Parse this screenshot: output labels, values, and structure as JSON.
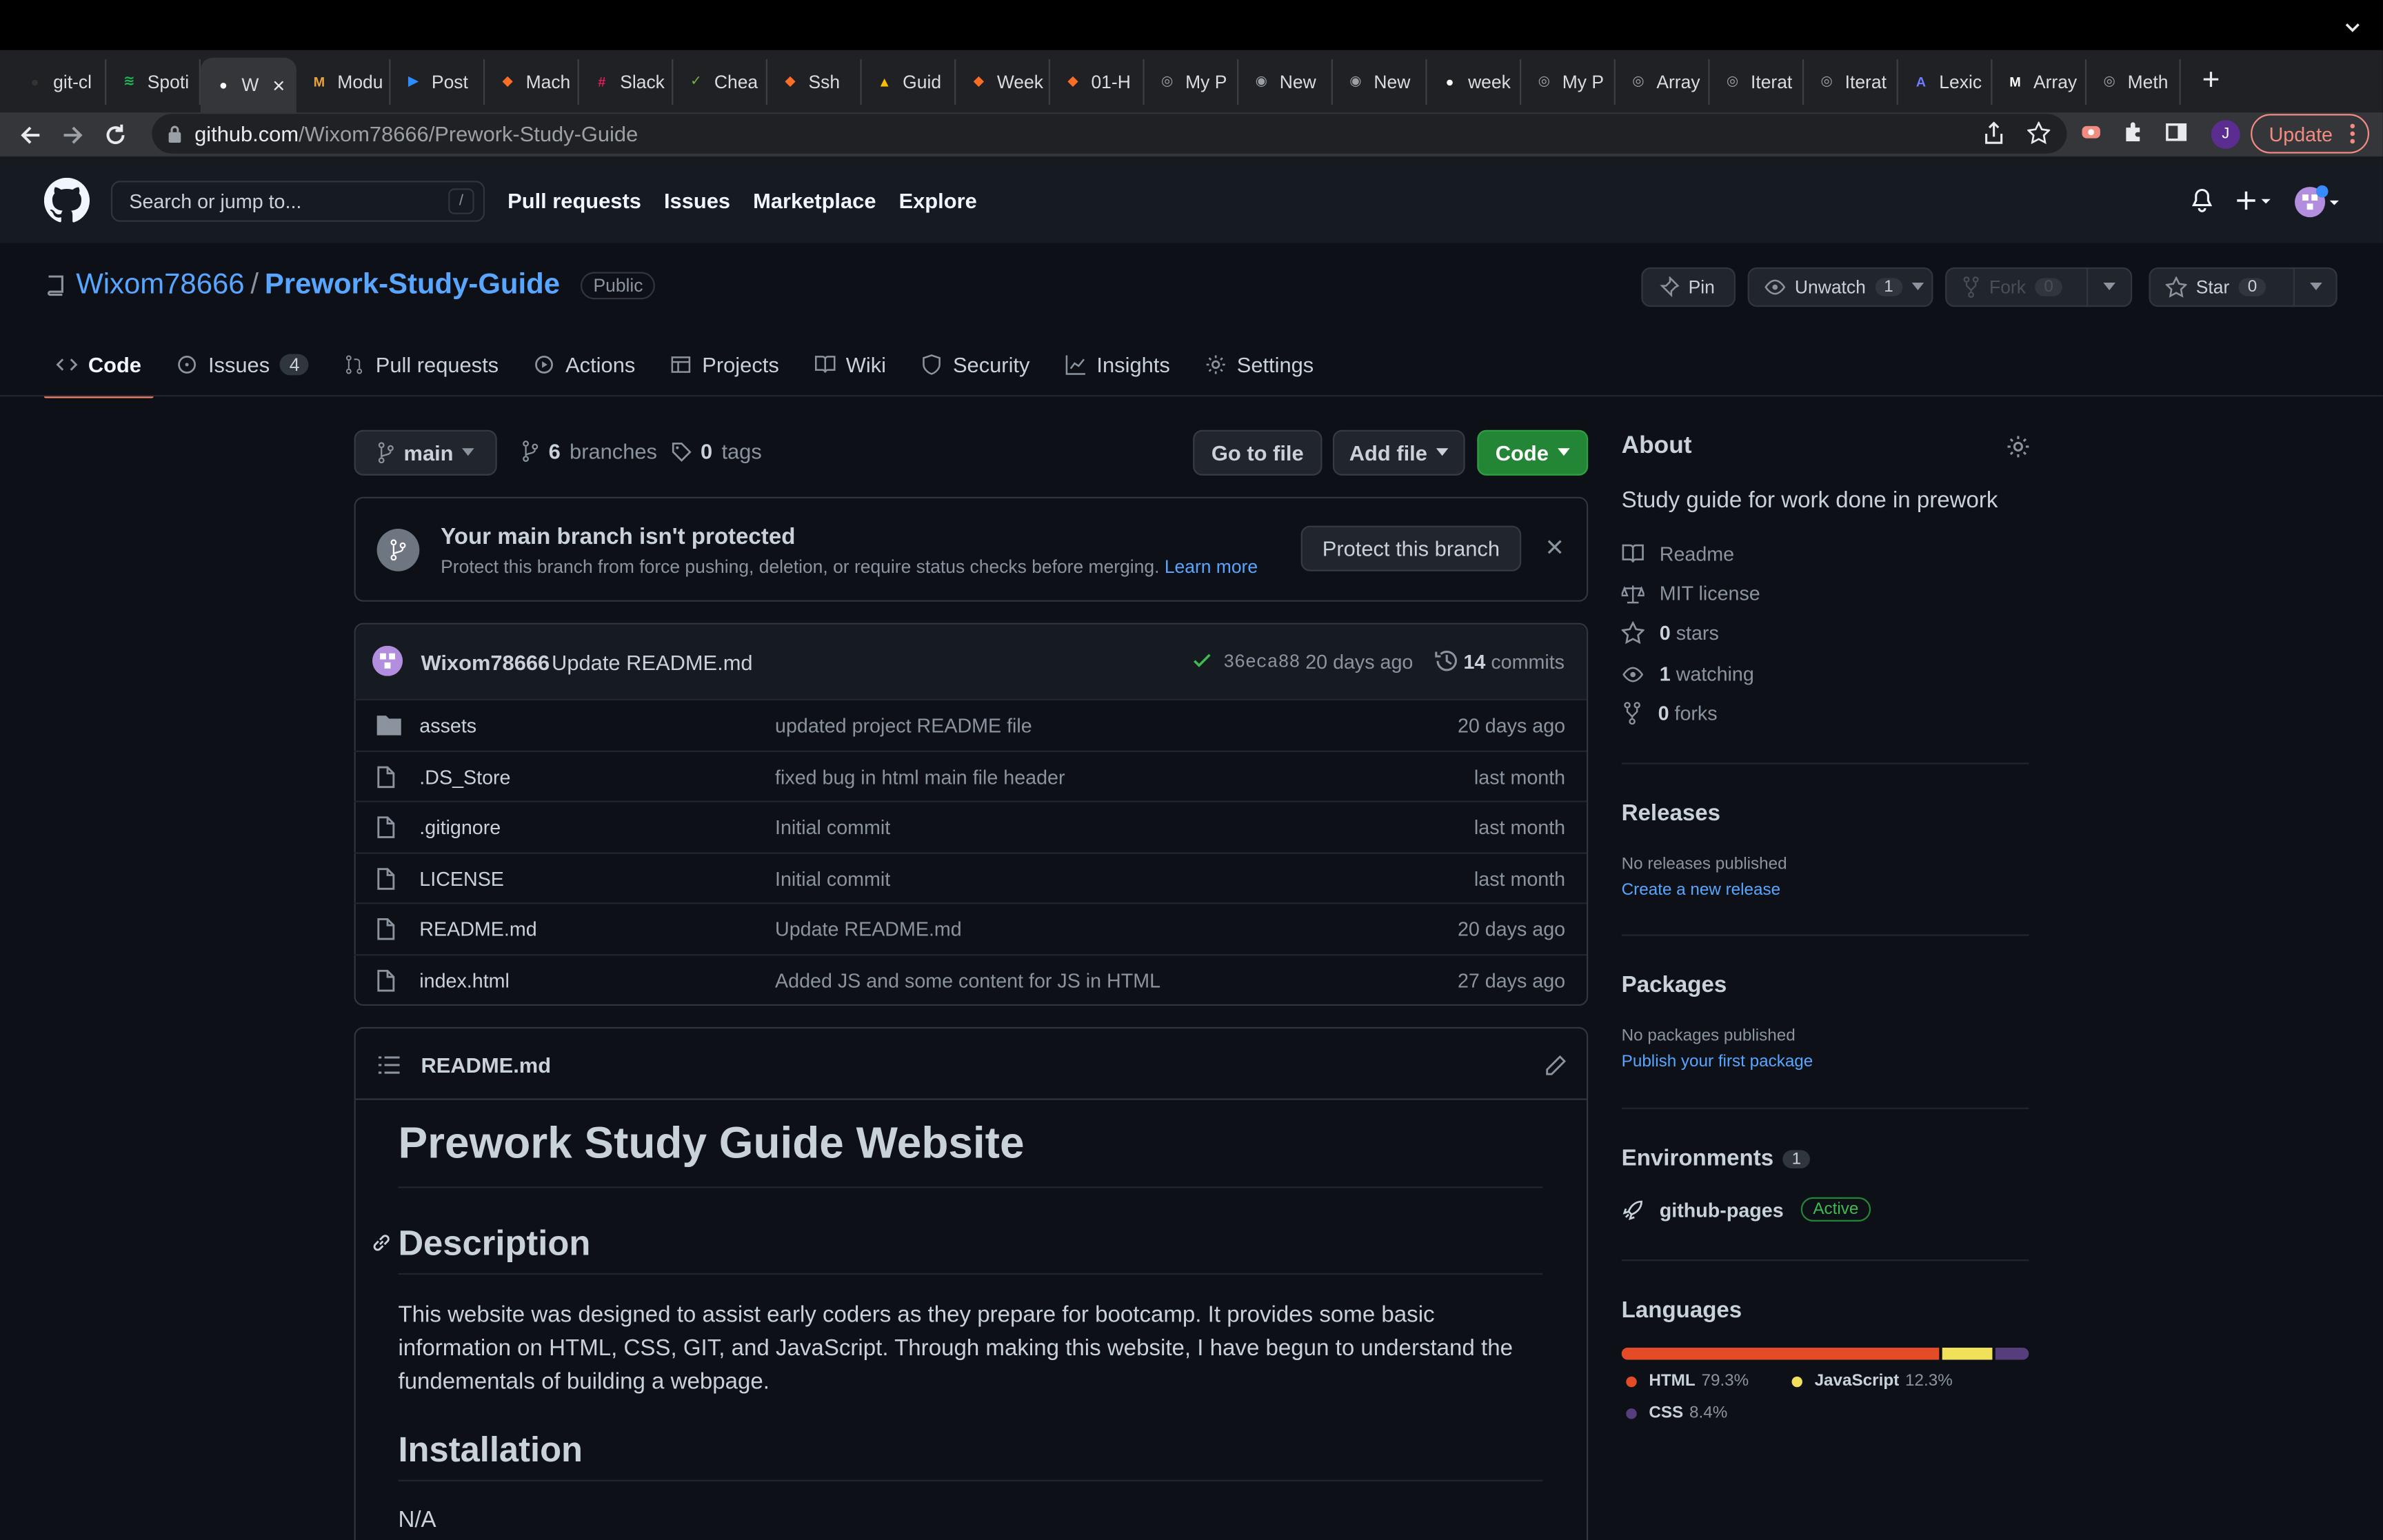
{
  "browser": {
    "tabs": [
      {
        "label": "git-cl",
        "icon": "github-icon",
        "color": "#333"
      },
      {
        "label": "Spoti",
        "icon": "spotify-icon",
        "color": "#1db954"
      },
      {
        "label": "W",
        "icon": "github-icon",
        "color": "#fff",
        "active": true
      },
      {
        "label": "Modu",
        "icon": "module-icon",
        "color": "#e8a33d"
      },
      {
        "label": "Post",
        "icon": "zoom-icon",
        "color": "#2d8cff"
      },
      {
        "label": "Mach",
        "icon": "gitlab-icon",
        "color": "#fc6d26"
      },
      {
        "label": "Slack",
        "icon": "slack-icon",
        "color": "#e01e5a"
      },
      {
        "label": "Chea",
        "icon": "cheatsheet-icon",
        "color": "#7cb342"
      },
      {
        "label": "Ssh",
        "icon": "gitlab-icon",
        "color": "#fc6d26"
      },
      {
        "label": "Guid",
        "icon": "google-drive-icon",
        "color": "#fbbc04"
      },
      {
        "label": "Week",
        "icon": "gitlab-icon",
        "color": "#fc6d26"
      },
      {
        "label": "01-H",
        "icon": "gitlab-icon",
        "color": "#fc6d26"
      },
      {
        "label": "My P",
        "icon": "globe-icon",
        "color": "#9aa0a6"
      },
      {
        "label": "New",
        "icon": "chrome-icon",
        "color": "#9aa0a6"
      },
      {
        "label": "New",
        "icon": "chrome-icon",
        "color": "#9aa0a6"
      },
      {
        "label": "week",
        "icon": "github-icon",
        "color": "#fff"
      },
      {
        "label": "My P",
        "icon": "globe-icon",
        "color": "#9aa0a6"
      },
      {
        "label": "Array",
        "icon": "globe-icon",
        "color": "#9aa0a6"
      },
      {
        "label": "Iterat",
        "icon": "globe-icon",
        "color": "#9aa0a6"
      },
      {
        "label": "Iterat",
        "icon": "globe-icon",
        "color": "#9aa0a6"
      },
      {
        "label": "Lexic",
        "icon": "lexical-icon",
        "color": "#6e7bff"
      },
      {
        "label": "Array",
        "icon": "mdn-icon",
        "color": "#fff"
      },
      {
        "label": "Meth",
        "icon": "globe-icon",
        "color": "#9aa0a6"
      }
    ],
    "url_host": "github.com",
    "url_path": "/Wixom78666/Prework-Study-Guide",
    "update_label": "Update",
    "profile_initial": "J"
  },
  "header": {
    "search_placeholder": "Search or jump to...",
    "search_shortcut": "/",
    "nav": [
      "Pull requests",
      "Issues",
      "Marketplace",
      "Explore"
    ]
  },
  "repo": {
    "owner": "Wixom78666",
    "separator": "/",
    "name": "Prework-Study-Guide",
    "visibility": "Public",
    "pin_label": "Pin",
    "watch_label": "Unwatch",
    "watch_count": "1",
    "fork_label": "Fork",
    "fork_count": "0",
    "star_label": "Star",
    "star_count": "0",
    "tabs": [
      {
        "label": "Code",
        "icon": "code-icon"
      },
      {
        "label": "Issues",
        "icon": "issue-icon",
        "count": "4"
      },
      {
        "label": "Pull requests",
        "icon": "pull-request-icon"
      },
      {
        "label": "Actions",
        "icon": "play-icon"
      },
      {
        "label": "Projects",
        "icon": "table-icon"
      },
      {
        "label": "Wiki",
        "icon": "book-icon"
      },
      {
        "label": "Security",
        "icon": "shield-icon"
      },
      {
        "label": "Insights",
        "icon": "graph-icon"
      },
      {
        "label": "Settings",
        "icon": "gear-icon"
      }
    ]
  },
  "toolbar": {
    "branch": "main",
    "branches_count": "6",
    "branches_label": "branches",
    "tags_count": "0",
    "tags_label": "tags",
    "go_to_file": "Go to file",
    "add_file": "Add file",
    "code": "Code"
  },
  "protect": {
    "title": "Your main branch isn't protected",
    "subtitle": "Protect this branch from force pushing, deletion, or require status checks before merging.",
    "learn_more": "Learn more",
    "button": "Protect this branch"
  },
  "commit": {
    "author": "Wixom78666",
    "message": "Update README.md",
    "sha": "36eca88",
    "age": "20 days ago",
    "commits_count": "14",
    "commits_label": "commits"
  },
  "files": [
    {
      "name": "assets",
      "type": "folder",
      "message": "updated project README file",
      "age": "20 days ago"
    },
    {
      "name": ".DS_Store",
      "type": "file",
      "message": "fixed bug in html main file header",
      "age": "last month"
    },
    {
      "name": ".gitignore",
      "type": "file",
      "message": "Initial commit",
      "age": "last month"
    },
    {
      "name": "LICENSE",
      "type": "file",
      "message": "Initial commit",
      "age": "last month"
    },
    {
      "name": "README.md",
      "type": "file",
      "message": "Update README.md",
      "age": "20 days ago"
    },
    {
      "name": "index.html",
      "type": "file",
      "message": "Added JS and some content for JS in HTML",
      "age": "27 days ago"
    }
  ],
  "readme": {
    "filename": "README.md",
    "h1": "Prework Study Guide Website",
    "h2_description": "Description",
    "description": "This website was designed to assist early coders as they prepare for bootcamp. It provides some basic information on HTML, CSS, GIT, and JavaScript. Through making this website, I have begun to understand the fundementals of building a webpage.",
    "h2_installation": "Installation",
    "installation": "N/A"
  },
  "about": {
    "title": "About",
    "description": "Study guide for work done in prework",
    "readme": "Readme",
    "license": "MIT license",
    "stars_count": "0",
    "stars_label": "stars",
    "watching_count": "1",
    "watching_label": "watching",
    "forks_count": "0",
    "forks_label": "forks"
  },
  "releases": {
    "title": "Releases",
    "none": "No releases published",
    "create": "Create a new release"
  },
  "packages": {
    "title": "Packages",
    "none": "No packages published",
    "publish": "Publish your first package"
  },
  "environments": {
    "title": "Environments",
    "count": "1",
    "name": "github-pages",
    "status": "Active"
  },
  "languages": {
    "title": "Languages",
    "items": [
      {
        "name": "HTML",
        "percent": "79.3%",
        "value": 79.3,
        "color": "#e34c26"
      },
      {
        "name": "JavaScript",
        "percent": "12.3%",
        "value": 12.3,
        "color": "#f1e05a"
      },
      {
        "name": "CSS",
        "percent": "8.4%",
        "value": 8.4,
        "color": "#563d7c"
      }
    ]
  }
}
